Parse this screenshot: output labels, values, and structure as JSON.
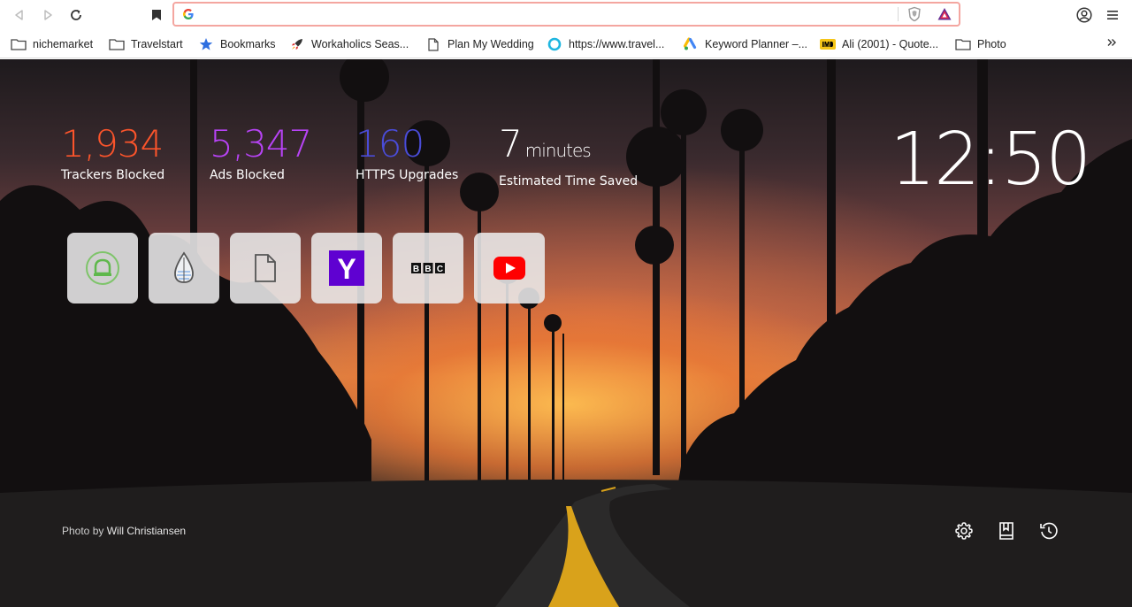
{
  "toolbar": {
    "url_value": "",
    "url_placeholder": ""
  },
  "bookmarks": [
    {
      "label": "nichemarket",
      "icon": "folder-icon"
    },
    {
      "label": "Travelstart",
      "icon": "folder-icon"
    },
    {
      "label": "Bookmarks",
      "icon": "star-icon"
    },
    {
      "label": "Workaholics Seas...",
      "icon": "rocket-icon"
    },
    {
      "label": "Plan My Wedding",
      "icon": "page-icon"
    },
    {
      "label": "https://www.travel...",
      "icon": "ring-icon"
    },
    {
      "label": "Keyword Planner –...",
      "icon": "google-ads-icon"
    },
    {
      "label": "Ali (2001) - Quote...",
      "icon": "imdb-icon"
    },
    {
      "label": "Photo",
      "icon": "folder-icon"
    }
  ],
  "stats": {
    "trackers": {
      "value": "1,934",
      "label": "Trackers Blocked",
      "color": "#fb542b"
    },
    "ads": {
      "value": "5,347",
      "label": "Ads Blocked",
      "color": "#b743f5"
    },
    "https": {
      "value": "160",
      "label": "HTTPS Upgrades",
      "color": "#4a4cd8"
    },
    "time": {
      "value": "7",
      "unit": "minutes",
      "label": "Estimated Time Saved",
      "color": "#ffffff"
    }
  },
  "clock": "12:50",
  "tiles": [
    {
      "name": "tile-android",
      "icon": "android-bell-icon"
    },
    {
      "name": "tile-drop",
      "icon": "water-drop-icon"
    },
    {
      "name": "tile-document",
      "icon": "document-icon"
    },
    {
      "name": "tile-yahoo",
      "icon": "yahoo-icon",
      "text": "Y"
    },
    {
      "name": "tile-bbc",
      "icon": "bbc-icon",
      "text": [
        "B",
        "B",
        "C"
      ]
    },
    {
      "name": "tile-youtube",
      "icon": "youtube-icon"
    }
  ],
  "photo_credit": {
    "prefix": "Photo by",
    "author": "Will Christiansen"
  },
  "corner": {
    "settings_icon": "gear-icon",
    "bookmarks_icon": "bookmark-book-icon",
    "history_icon": "history-icon"
  }
}
